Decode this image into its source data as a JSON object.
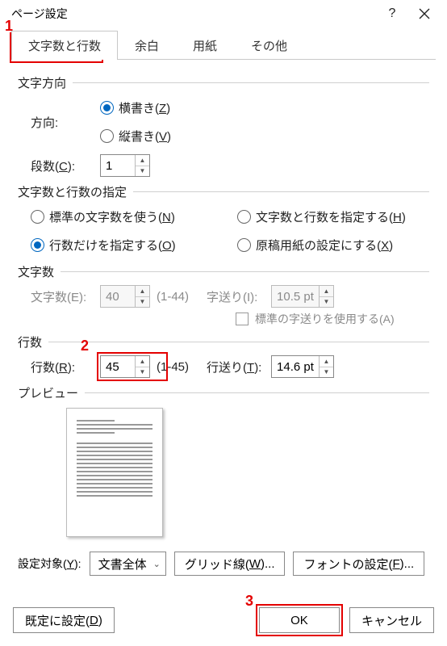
{
  "title": "ページ設定",
  "tabs": [
    "文字数と行数",
    "余白",
    "用紙",
    "その他"
  ],
  "sections": {
    "direction": "文字方向",
    "spec": "文字数と行数の指定",
    "chars": "文字数",
    "lines": "行数",
    "preview": "プレビュー"
  },
  "direction": {
    "label": "方向:",
    "horizontal": "横書き(Z)",
    "vertical": "縦書き(V)",
    "columns_label": "段数(C):",
    "columns_value": "1"
  },
  "spec": {
    "standard": "標準の文字数を使う(N)",
    "chars_lines": "文字数と行数を指定する(H)",
    "lines_only": "行数だけを指定する(O)",
    "manuscript": "原稿用紙の設定にする(X)"
  },
  "chars": {
    "label": "文字数(E):",
    "value": "40",
    "range": "(1-44)",
    "pitch_label": "字送り(I):",
    "pitch_value": "10.5 pt",
    "std_pitch": "標準の字送りを使用する(A)"
  },
  "lines": {
    "label": "行数(R):",
    "value": "45",
    "range": "(1-45)",
    "pitch_label": "行送り(T):",
    "pitch_value": "14.6 pt"
  },
  "apply": {
    "label": "設定対象(Y):",
    "value": "文書全体",
    "grid_btn": "グリッド線(W)...",
    "font_btn": "フォントの設定(F)..."
  },
  "footer": {
    "default": "既定に設定(D)",
    "ok": "OK",
    "cancel": "キャンセル"
  },
  "annotations": {
    "n1": "1",
    "n2": "2",
    "n3": "3"
  }
}
